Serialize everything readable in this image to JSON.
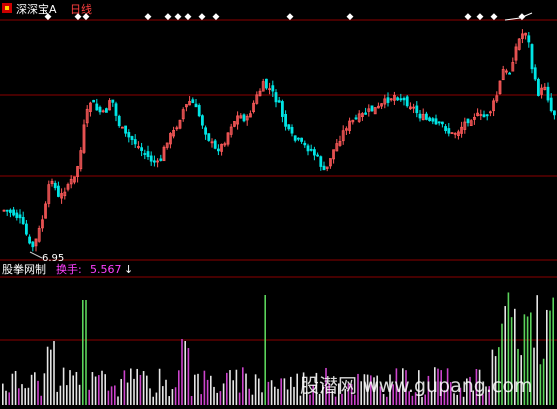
{
  "header": {
    "logo_icon": "app-logo-icon",
    "stock_name": "深深宝A",
    "period": "日线"
  },
  "indicator": {
    "name": "股拳网制",
    "label": "换手:",
    "value": "5.567",
    "arrow": "↓"
  },
  "price_chart": {
    "low_label": "6.95"
  },
  "watermark": {
    "text": "股潜网 www.gupang.com"
  },
  "colors": {
    "background": "#000000",
    "up_candle": "#ff5a5a",
    "down_candle": "#00e5e5",
    "grid": "#8b0000",
    "header_stock": "#ffffff",
    "header_period": "#ff4040",
    "indicator_label": "#ff40ff",
    "volume_green": "#5bd35b",
    "volume_magenta": "#cc44cc",
    "volume_white": "#e6e6e6"
  }
}
